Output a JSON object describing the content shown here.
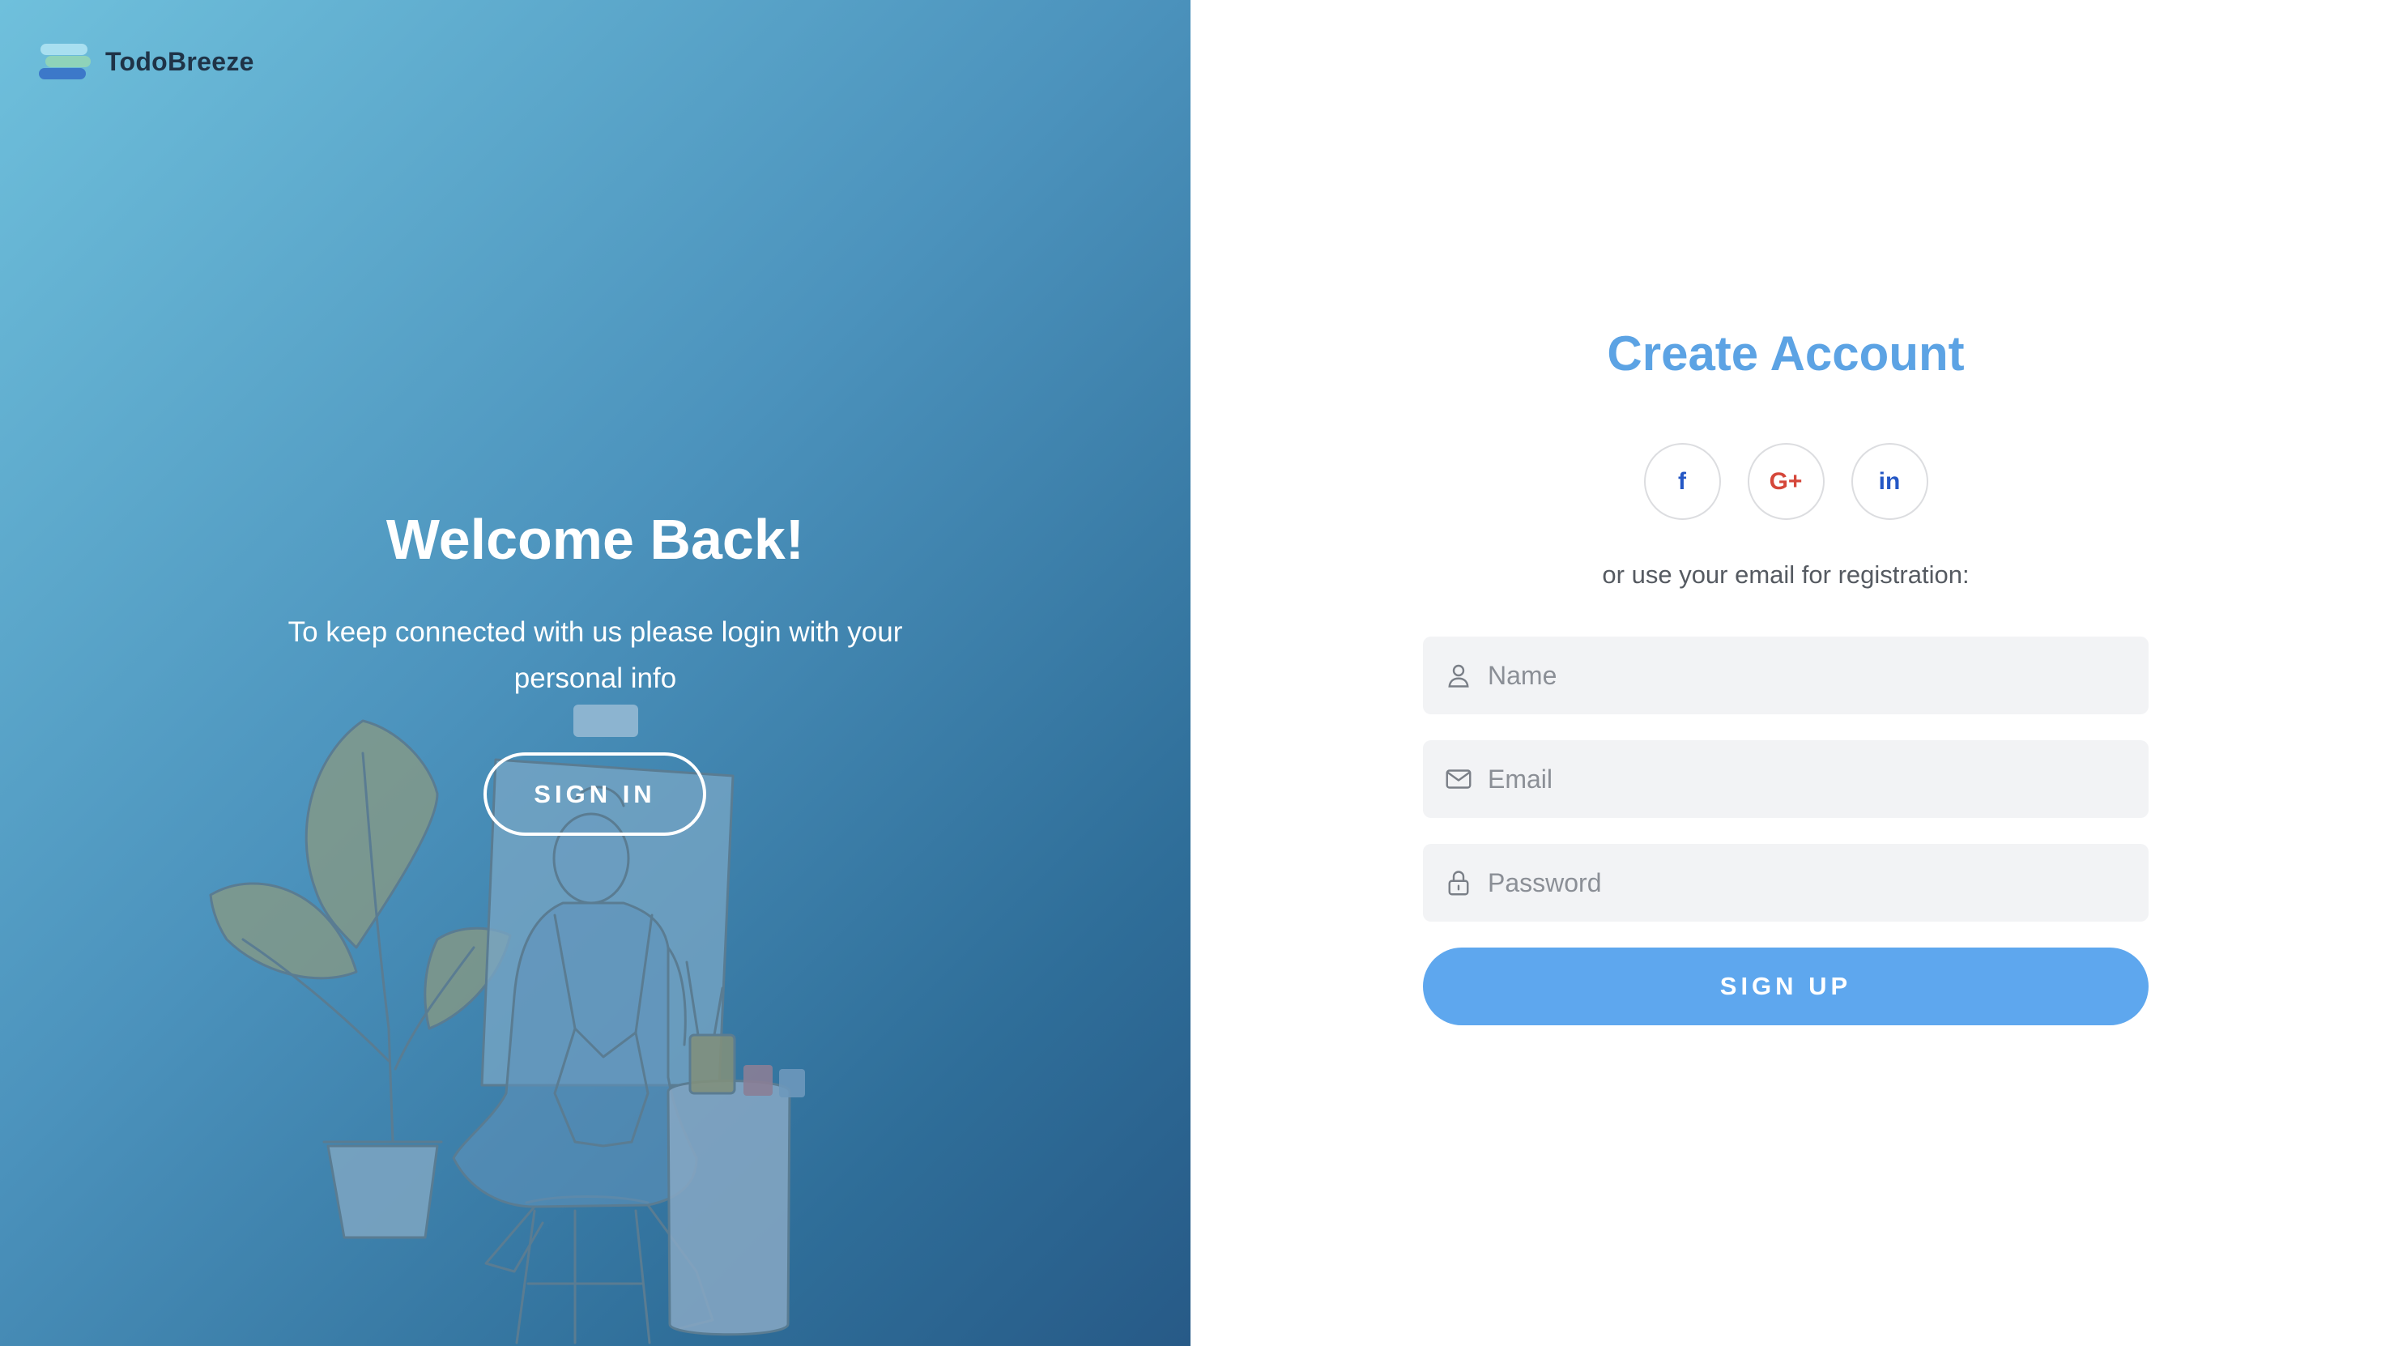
{
  "brand": {
    "name": "TodoBreeze"
  },
  "welcome": {
    "title": "Welcome Back!",
    "text": "To keep connected with us please login with your personal info",
    "signin_label": "SIGN IN"
  },
  "signup": {
    "title": "Create Account",
    "socials": [
      {
        "label": "f",
        "icon": "facebook-icon",
        "color": "#2457c5"
      },
      {
        "label": "G+",
        "icon": "google-plus-icon",
        "color": "#d5473a"
      },
      {
        "label": "in",
        "icon": "linkedin-icon",
        "color": "#2457c5"
      }
    ],
    "or_text": "or use your email for registration:",
    "fields": {
      "name": {
        "placeholder": "Name",
        "icon": "user-icon"
      },
      "email": {
        "placeholder": "Email",
        "icon": "mail-icon"
      },
      "password": {
        "placeholder": "Password",
        "icon": "lock-icon"
      }
    },
    "signup_label": "SIGN UP"
  },
  "colors": {
    "accent": "#5ea7ee",
    "title": "#5ca3e4",
    "field_bg": "#f2f3f5",
    "panel_gradient_start": "#6fc0dc",
    "panel_gradient_end": "#275a87"
  }
}
